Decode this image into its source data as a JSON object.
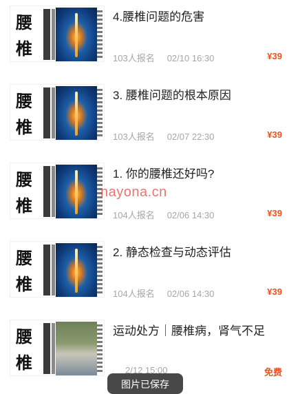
{
  "courses": [
    {
      "thumb_char_1": "腰",
      "thumb_char_2": "椎",
      "title": "4.腰椎问题的危害",
      "enrolled": "103人报名",
      "datetime": "02/10 16:30",
      "price": "¥39"
    },
    {
      "thumb_char_1": "腰",
      "thumb_char_2": "椎",
      "title": "3. 腰椎问题的根本原因",
      "enrolled": "103人报名",
      "datetime": "02/07 22:30",
      "price": "¥39"
    },
    {
      "thumb_char_1": "腰",
      "thumb_char_2": "椎",
      "title": "1. 你的腰椎还好吗?",
      "enrolled": "104人报名",
      "datetime": "02/06 14:30",
      "price": "¥39"
    },
    {
      "thumb_char_1": "腰",
      "thumb_char_2": "椎",
      "title": "2. 静态检查与动态评估",
      "enrolled": "104人报名",
      "datetime": "02/06 14:30",
      "price": "¥39"
    },
    {
      "thumb_char_1": "腰",
      "thumb_char_2": "椎",
      "title": "运动处方｜腰椎病，肾气不足",
      "enrolled": "",
      "datetime": "2/12 15:00",
      "price": "免费"
    }
  ],
  "watermark": "nayona.cn",
  "toast": "图片已保存",
  "colors": {
    "price": "#e8541e",
    "meta": "#a6a6a6",
    "title": "#222222"
  }
}
